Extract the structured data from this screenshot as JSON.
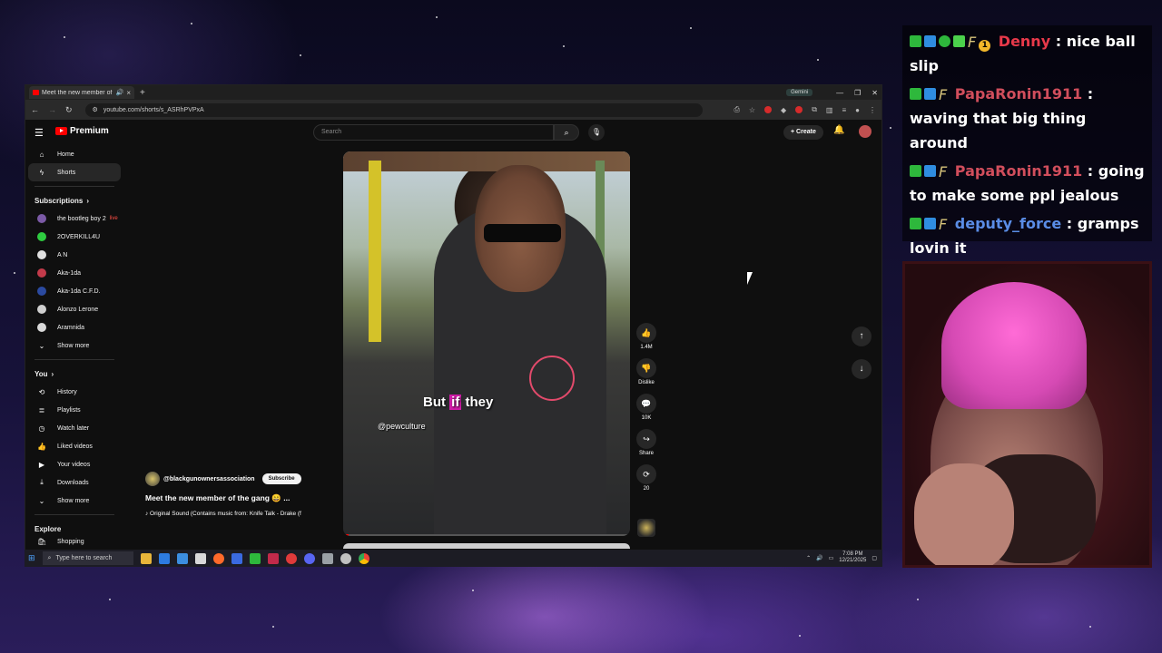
{
  "browser": {
    "tab_title": "Meet the new member of th",
    "gemini_label": "Gemini",
    "url": "youtube.com/shorts/s_ASRhPVPxA"
  },
  "youtube": {
    "logo_text": "Premium",
    "search_placeholder": "Search",
    "create_label": "Create"
  },
  "sidebar": {
    "home": "Home",
    "shorts": "Shorts",
    "subscriptions_header": "Subscriptions",
    "subscriptions": [
      {
        "label": "the bootleg boy 2",
        "color": "#7b5aa6",
        "live": "live"
      },
      {
        "label": "2OVERKILL4U",
        "color": "#2ecc40"
      },
      {
        "label": "A N",
        "color": "#e0e0e0"
      },
      {
        "label": "Aka-1da",
        "color": "#c33a4a"
      },
      {
        "label": "Aka-1da C.F.D.",
        "color": "#2b4aa0"
      },
      {
        "label": "Alonzo Lerone",
        "color": "#cfcfcf"
      },
      {
        "label": "Aramnida",
        "color": "#d9d9d9"
      }
    ],
    "show_more": "Show more",
    "you_header": "You",
    "you_items": [
      "History",
      "Playlists",
      "Watch later",
      "Liked videos",
      "Your videos",
      "Downloads"
    ],
    "show_more_2": "Show more",
    "explore_header": "Explore",
    "explore_first": "Shopping"
  },
  "video": {
    "caption_pre": "But ",
    "caption_hl": "if",
    "caption_post": " they",
    "watermark": "@pewculture",
    "progress": 0.02
  },
  "actions": {
    "likes": "1.4M",
    "dislike": "Dislike",
    "comments": "10K",
    "share": "Share",
    "remix": "20"
  },
  "meta": {
    "channel": "@blackgunownersassociation",
    "subscribe": "Subscribe",
    "title": "Meet the new member of the gang 😄 ...",
    "sound": "♪ Original Sound (Contains music from: Knife Talk - Drake (f"
  },
  "taskbar": {
    "search_placeholder": "Type here to search",
    "time": "7:08 PM",
    "date": "12/21/2025"
  },
  "chat": [
    {
      "user": "Denny",
      "color": "u-red",
      "text": "nice ball slip"
    },
    {
      "user": "PapaRonin1911",
      "color": "u-pink",
      "text": "waving that big thing around"
    },
    {
      "user": "PapaRonin1911",
      "color": "u-pink",
      "text": "going to make some ppl jealous"
    },
    {
      "user": "deputy_force",
      "color": "u-blue",
      "text": "gramps lovin it"
    }
  ]
}
